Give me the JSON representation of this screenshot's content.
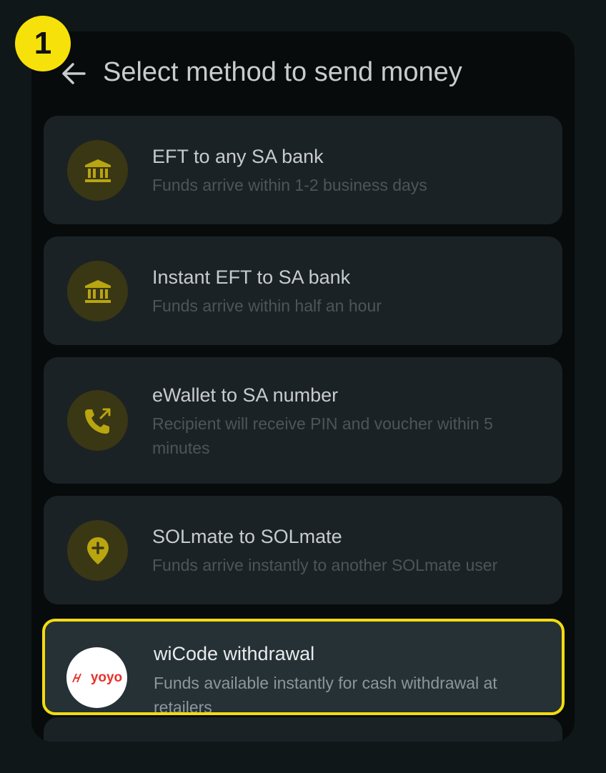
{
  "step_badge": "1",
  "header": {
    "back_icon": "arrow-left-icon",
    "title": "Select method to send money"
  },
  "methods": [
    {
      "icon": "bank-icon",
      "title": "EFT to any SA bank",
      "subtitle": "Funds arrive within 1-2 business days"
    },
    {
      "icon": "bank-icon",
      "title": "Instant EFT to SA bank",
      "subtitle": "Funds arrive within half an hour"
    },
    {
      "icon": "phone-forward-icon",
      "title": "eWallet to SA number",
      "subtitle": "Recipient will receive PIN and voucher within 5 minutes"
    },
    {
      "icon": "location-plus-icon",
      "title": "SOLmate to SOLmate",
      "subtitle": "Funds arrive instantly to another SOLmate user"
    },
    {
      "icon": "yoyo-logo",
      "logo_text": "yoyo",
      "title": "wiCode withdrawal",
      "subtitle": "Funds available instantly for cash withdrawal at retailers",
      "highlighted": true
    }
  ],
  "colors": {
    "accent": "#f4dc0e",
    "icon_gold": "#b8a510",
    "card_bg": "#1b2225",
    "highlight_bg": "#263136",
    "yoyo_red": "#e8322c"
  }
}
